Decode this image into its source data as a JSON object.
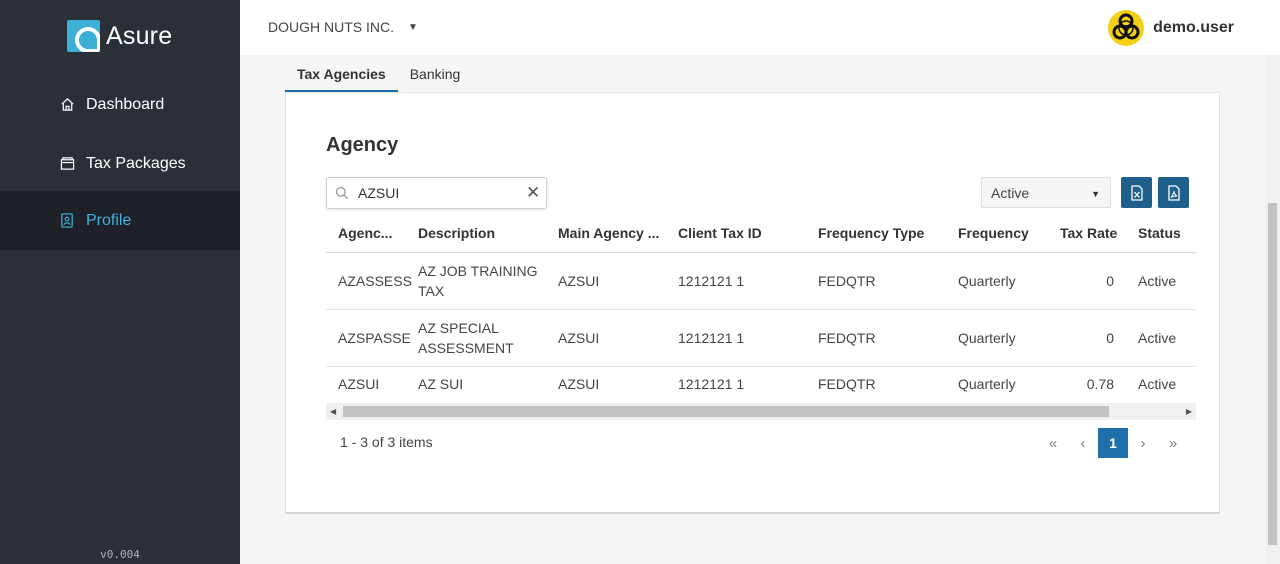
{
  "app": {
    "name": "Asure",
    "version": "v0.004"
  },
  "sidebar": {
    "items": [
      {
        "label": "Dashboard",
        "icon": "home-icon"
      },
      {
        "label": "Tax Packages",
        "icon": "package-icon"
      },
      {
        "label": "Profile",
        "icon": "profile-icon",
        "active": true
      }
    ]
  },
  "topbar": {
    "company": "DOUGH NUTS INC.",
    "username": "demo.user",
    "avatar_icon": "biohazard-icon"
  },
  "tabs": [
    {
      "label": "Tax Agencies",
      "active": true
    },
    {
      "label": "Banking"
    }
  ],
  "card": {
    "title": "Agency",
    "search": {
      "value": "AZSUI",
      "placeholder": ""
    },
    "status_filter": {
      "selected": "Active"
    },
    "export": {
      "excel_icon": "excel-file-icon",
      "pdf_icon": "pdf-file-icon"
    }
  },
  "grid": {
    "columns": [
      "Agenc...",
      "Description",
      "Main Agency ...",
      "Client Tax ID",
      "Frequency Type",
      "Frequency",
      "Tax Rate",
      "Status"
    ],
    "rows": [
      {
        "agency": "AZASSESS",
        "description": "AZ JOB TRAINING TAX",
        "main_agency": "AZSUI",
        "client_tax_id": "1212121 1",
        "frequency_type": "FEDQTR",
        "frequency": "Quarterly",
        "tax_rate": "0",
        "status": "Active"
      },
      {
        "agency": "AZSPASSE",
        "description": "AZ SPECIAL ASSESSMENT",
        "main_agency": "AZSUI",
        "client_tax_id": "1212121 1",
        "frequency_type": "FEDQTR",
        "frequency": "Quarterly",
        "tax_rate": "0",
        "status": "Active"
      },
      {
        "agency": "AZSUI",
        "description": "AZ SUI",
        "main_agency": "AZSUI",
        "client_tax_id": "1212121 1",
        "frequency_type": "FEDQTR",
        "frequency": "Quarterly",
        "tax_rate": "0.78",
        "status": "Active"
      }
    ]
  },
  "pagination": {
    "info": "1 - 3 of 3 items",
    "current_page": "1"
  },
  "colors": {
    "sidebar_bg": "#2b3038",
    "accent": "#3db5e0",
    "primary": "#1f70aa"
  }
}
